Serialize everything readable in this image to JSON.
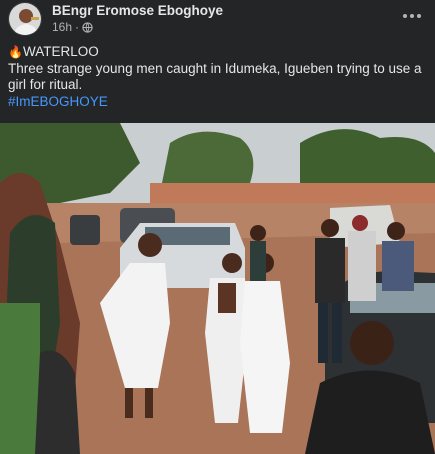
{
  "post": {
    "author": "BEngr Eromose Eboghoye",
    "timestamp": "16h",
    "privacy_icon": "globe-icon",
    "more_icon": "more-options-icon",
    "headline_emoji": "🔥",
    "headline": "WATERLOO",
    "body_line1": "Three strange young men caught in Idumeka, Igueben trying to use a",
    "body_line2": "girl for ritual.",
    "hashtag": "#ImEBOGHOYE"
  },
  "colors": {
    "background": "#242526",
    "text_primary": "#e4e6eb",
    "text_secondary": "#b0b3b8",
    "link": "#4599ff"
  }
}
